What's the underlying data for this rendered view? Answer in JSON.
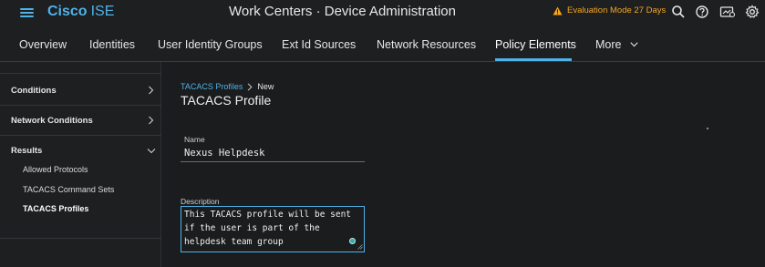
{
  "header": {
    "brand_strong": "Cisco",
    "brand_light": "ISE",
    "title": "Work Centers · Device Administration",
    "eval_mode": "Evaluation Mode 27 Days"
  },
  "nav": {
    "tabs": [
      {
        "label": "Overview"
      },
      {
        "label": "Identities"
      },
      {
        "label": "User Identity Groups"
      },
      {
        "label": "Ext Id Sources"
      },
      {
        "label": "Network Resources"
      },
      {
        "label": "Policy Elements"
      },
      {
        "label": "More"
      }
    ],
    "active_tab": "Policy Elements"
  },
  "sidebar": {
    "sections": [
      {
        "label": "Conditions",
        "expanded": false
      },
      {
        "label": "Network Conditions",
        "expanded": false
      },
      {
        "label": "Results",
        "expanded": true
      }
    ],
    "results_items": [
      {
        "label": "Allowed Protocols"
      },
      {
        "label": "TACACS Command Sets"
      },
      {
        "label": "TACACS Profiles"
      }
    ],
    "active_item": "TACACS Profiles"
  },
  "main": {
    "breadcrumb": {
      "parent": "TACACS Profiles",
      "current": "New"
    },
    "title": "TACACS Profile",
    "name_field": {
      "label": "Name",
      "value": "Nexus Helpdesk"
    },
    "description_field": {
      "label": "Description",
      "value": "This TACACS profile will be sent if the user is part of the helpdesk team group"
    }
  },
  "colors": {
    "accent": "#4fb2e8",
    "warning": "#f5a623",
    "background": "#1a1c1e"
  },
  "icons": [
    "menu-icon",
    "warning-icon",
    "search-icon",
    "help-icon",
    "notifications-icon",
    "settings-icon",
    "chevron-down-icon",
    "chevron-right-icon"
  ]
}
